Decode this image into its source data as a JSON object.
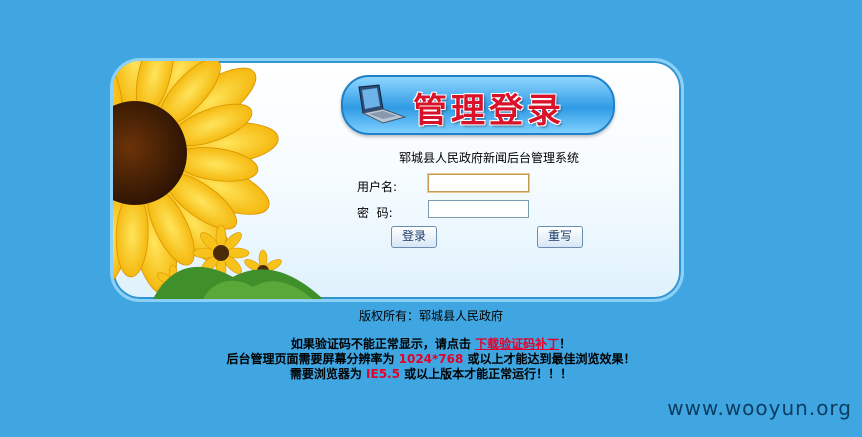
{
  "header": {
    "title": "管理登录",
    "subtitle": "郓城县人民政府新闻后台管理系统"
  },
  "form": {
    "username_label": "用户名:",
    "username_value": "",
    "password_label": "密  码:",
    "password_value": "",
    "login_button": "登录",
    "reset_button": "重写"
  },
  "footer": {
    "copyright": "版权所有：郓城县人民政府",
    "line1_before": "如果验证码不能正常显示，请点击 ",
    "line1_link": "下载验证码补丁",
    "line1_after": "！",
    "line2_before": "后台管理页面需要屏幕分辨率为 ",
    "line2_highlight": "1024*768",
    "line2_after": " 或以上才能达到最佳浏览效果！",
    "line3_before": "需要浏览器为 ",
    "line3_highlight": "IE5.5",
    "line3_after": " 或以上版本才能正常运行！！！"
  },
  "watermark": "www.wooyun.org",
  "colors": {
    "background": "#3fa6e2",
    "title_red": "#d9122a",
    "highlight_red": "#e4002b"
  },
  "icons": {
    "banner_icon": "laptop-icon",
    "decoration": "sunflower-image"
  }
}
